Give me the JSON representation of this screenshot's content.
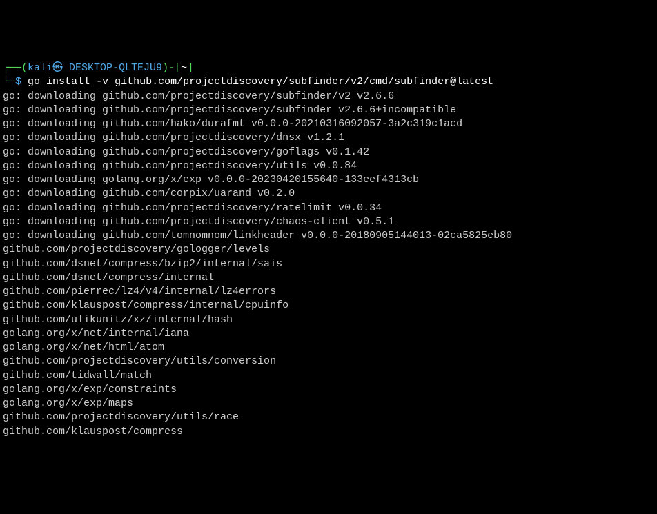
{
  "prompt": {
    "open_box": "┌──",
    "paren_open": "(",
    "user_host": "kali㉿ DESKTOP-QLTEJU9",
    "paren_close": ")",
    "dash": "-",
    "bracket_open": "[",
    "path": "~",
    "bracket_close": "]",
    "down_box": "└─",
    "symbol": "$",
    "command": "go install -v github.com/projectdiscovery/subfinder/v2/cmd/subfinder@latest"
  },
  "output_lines": [
    "go: downloading github.com/projectdiscovery/subfinder/v2 v2.6.6",
    "go: downloading github.com/projectdiscovery/subfinder v2.6.6+incompatible",
    "go: downloading github.com/hako/durafmt v0.0.0-20210316092057-3a2c319c1acd",
    "go: downloading github.com/projectdiscovery/dnsx v1.2.1",
    "go: downloading github.com/projectdiscovery/goflags v0.1.42",
    "go: downloading github.com/projectdiscovery/utils v0.0.84",
    "go: downloading golang.org/x/exp v0.0.0-20230420155640-133eef4313cb",
    "go: downloading github.com/corpix/uarand v0.2.0",
    "go: downloading github.com/projectdiscovery/ratelimit v0.0.34",
    "go: downloading github.com/projectdiscovery/chaos-client v0.5.1",
    "go: downloading github.com/tomnomnom/linkheader v0.0.0-20180905144013-02ca5825eb80",
    "github.com/projectdiscovery/gologger/levels",
    "github.com/dsnet/compress/bzip2/internal/sais",
    "github.com/dsnet/compress/internal",
    "github.com/pierrec/lz4/v4/internal/lz4errors",
    "github.com/klauspost/compress/internal/cpuinfo",
    "github.com/ulikunitz/xz/internal/hash",
    "golang.org/x/net/internal/iana",
    "golang.org/x/net/html/atom",
    "github.com/projectdiscovery/utils/conversion",
    "github.com/tidwall/match",
    "golang.org/x/exp/constraints",
    "golang.org/x/exp/maps",
    "github.com/projectdiscovery/utils/race",
    "github.com/klauspost/compress"
  ]
}
